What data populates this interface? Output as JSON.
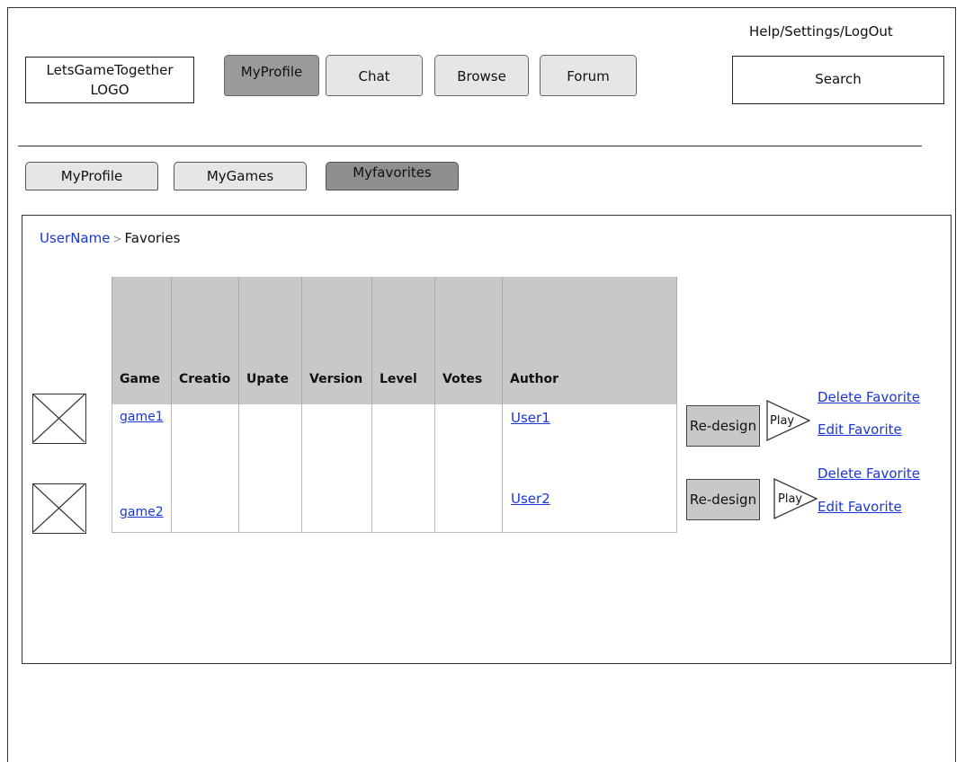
{
  "header": {
    "logo_line1": "LetsGameTogether",
    "logo_line2": "LOGO",
    "top_links": "Help/Settings/LogOut",
    "search_label": "Search",
    "nav_tabs": [
      {
        "label": "MyProfile",
        "active": true
      },
      {
        "label": "Chat",
        "active": false
      },
      {
        "label": "Browse",
        "active": false
      },
      {
        "label": "Forum",
        "active": false
      }
    ]
  },
  "subnav": {
    "tabs": [
      {
        "label": "MyProfile",
        "active": false
      },
      {
        "label": "MyGames",
        "active": false
      },
      {
        "label": "Myfavorites",
        "active": true
      }
    ]
  },
  "breadcrumb": {
    "user": "UserName",
    "separator": ">",
    "current": "Favories"
  },
  "table": {
    "columns": [
      "Game",
      "Creatio",
      "Upate",
      "Version",
      "Level",
      "Votes",
      "Author"
    ],
    "rows": [
      {
        "game": "game1",
        "author": "User1"
      },
      {
        "game": "game2",
        "author": "User2"
      }
    ]
  },
  "actions": {
    "redesign_label": "Re-design",
    "play_label": "Play",
    "delete_label": "Delete Favorite",
    "edit_label": "Edit Favorite"
  },
  "colors": {
    "link": "#1a36d9",
    "active_tab": "#9a9a9a",
    "header_fill": "#c8c8c8"
  }
}
